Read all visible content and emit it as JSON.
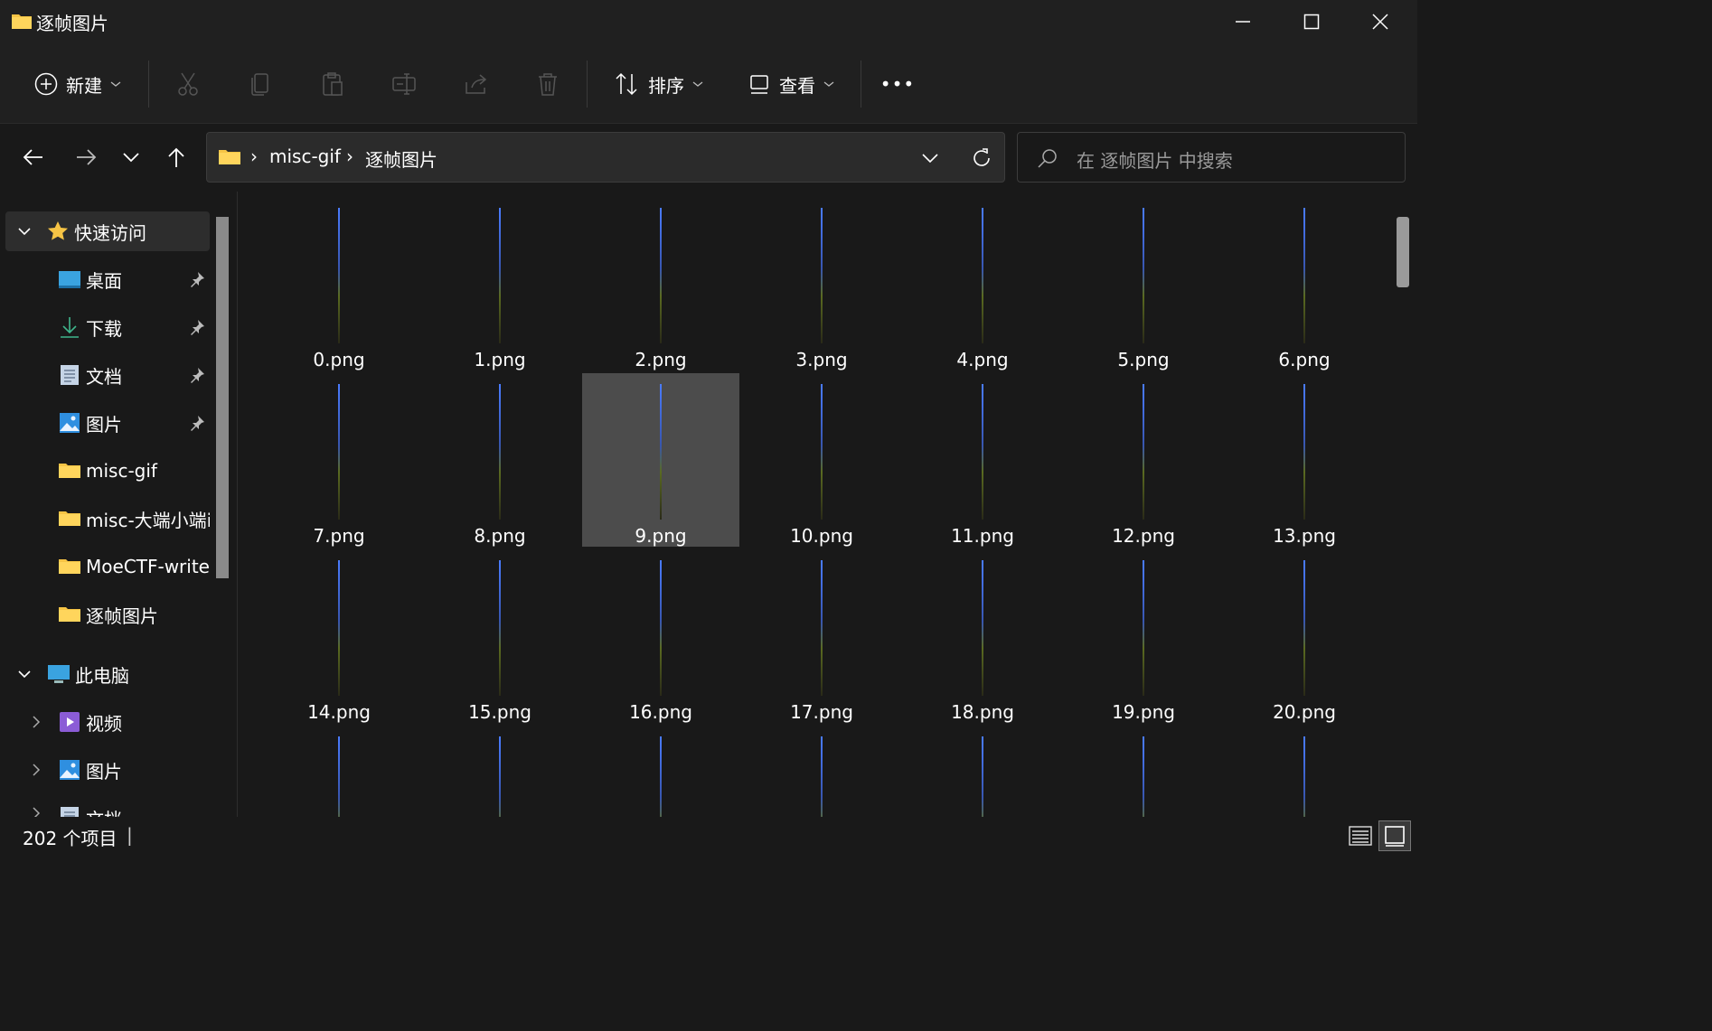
{
  "window": {
    "title": "逐帧图片",
    "controls": [
      "minimize",
      "maximize",
      "close"
    ]
  },
  "toolbar": {
    "new_label": "新建",
    "sort_label": "排序",
    "view_label": "查看",
    "more_label": "•••"
  },
  "address": {
    "crumbs": [
      "misc-gif",
      "逐帧图片"
    ],
    "separator": "›"
  },
  "search": {
    "placeholder": "在 逐帧图片 中搜索"
  },
  "sidebar": {
    "quick_access": "快速访问",
    "quick_items": [
      {
        "label": "桌面",
        "icon": "desktop-icon",
        "pinned": true
      },
      {
        "label": "下载",
        "icon": "download-icon",
        "pinned": true
      },
      {
        "label": "文档",
        "icon": "document-icon",
        "pinned": true
      },
      {
        "label": "图片",
        "icon": "pictures-icon",
        "pinned": true
      },
      {
        "label": "misc-gif",
        "icon": "folder-icon",
        "pinned": false
      },
      {
        "label": "misc-大端小端i",
        "icon": "folder-icon",
        "pinned": false
      },
      {
        "label": "MoeCTF-writeu",
        "icon": "folder-icon",
        "pinned": false
      },
      {
        "label": "逐帧图片",
        "icon": "folder-icon",
        "pinned": false
      }
    ],
    "this_pc": "此电脑",
    "pc_items": [
      {
        "label": "视频",
        "icon": "video-icon"
      },
      {
        "label": "图片",
        "icon": "pictures-icon"
      },
      {
        "label": "文档",
        "icon": "document-icon"
      }
    ]
  },
  "files": [
    "0.png",
    "1.png",
    "2.png",
    "3.png",
    "4.png",
    "5.png",
    "6.png",
    "7.png",
    "8.png",
    "9.png",
    "10.png",
    "11.png",
    "12.png",
    "13.png",
    "14.png",
    "15.png",
    "16.png",
    "17.png",
    "18.png",
    "19.png",
    "20.png",
    "",
    "",
    "",
    "",
    "",
    "",
    ""
  ],
  "selected_file": "9.png",
  "status": {
    "count_text": "202 个项目",
    "cursor": "|"
  },
  "colors": {
    "background": "#191919",
    "chrome": "#202020",
    "selection": "#4c4c4c",
    "folder": "#f6c445"
  }
}
